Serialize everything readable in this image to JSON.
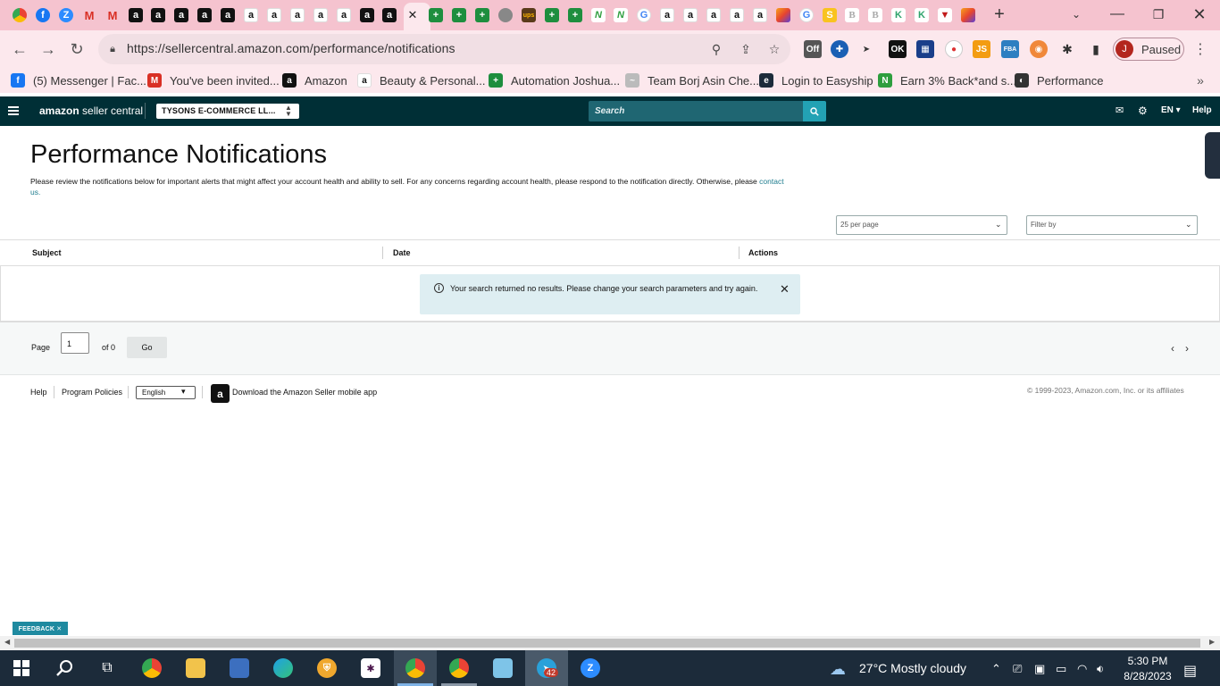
{
  "browser": {
    "tabs": [
      {
        "icon": "chrome-icon",
        "kind": "chrome",
        "glyph": ""
      },
      {
        "icon": "facebook-icon",
        "kind": "fb",
        "glyph": "f"
      },
      {
        "icon": "zoom-icon",
        "kind": "zoom",
        "glyph": "Z"
      },
      {
        "icon": "gmail-icon",
        "kind": "gmail",
        "glyph": "M"
      },
      {
        "icon": "gmail-icon",
        "kind": "gmail",
        "glyph": "M"
      },
      {
        "icon": "amazon-icon",
        "kind": "amz",
        "glyph": "a"
      },
      {
        "icon": "amazon-icon",
        "kind": "amz",
        "glyph": "a"
      },
      {
        "icon": "amazon-icon",
        "kind": "amz",
        "glyph": "a"
      },
      {
        "icon": "amazon-icon",
        "kind": "amz",
        "glyph": "a"
      },
      {
        "icon": "amazon-icon",
        "kind": "amz",
        "glyph": "a"
      },
      {
        "icon": "amazon-smile-icon",
        "kind": "amz2",
        "glyph": "a"
      },
      {
        "icon": "amazon-smile-icon",
        "kind": "amz2",
        "glyph": "a"
      },
      {
        "icon": "amazon-smile-icon",
        "kind": "amz2",
        "glyph": "a"
      },
      {
        "icon": "amazon-smile-icon",
        "kind": "amz2",
        "glyph": "a"
      },
      {
        "icon": "amazon-smile-icon",
        "kind": "amz2",
        "glyph": "a"
      },
      {
        "icon": "amazon-icon",
        "kind": "amz",
        "glyph": "a"
      },
      {
        "icon": "amazon-icon",
        "kind": "amz",
        "glyph": "a"
      },
      {
        "icon": "close-icon",
        "kind": "active",
        "glyph": "✕"
      },
      {
        "icon": "sheets-icon",
        "kind": "green",
        "glyph": "+"
      },
      {
        "icon": "sheets-icon",
        "kind": "green",
        "glyph": "+"
      },
      {
        "icon": "sheets-icon",
        "kind": "green",
        "glyph": "+"
      },
      {
        "icon": "globe-icon",
        "kind": "globe",
        "glyph": ""
      },
      {
        "icon": "ups-icon",
        "kind": "ups",
        "glyph": "ups"
      },
      {
        "icon": "sheets-icon",
        "kind": "green",
        "glyph": "+"
      },
      {
        "icon": "sheets-icon",
        "kind": "green",
        "glyph": "+"
      },
      {
        "icon": "wave-icon",
        "kind": "gn",
        "glyph": "N"
      },
      {
        "icon": "wave-icon",
        "kind": "gn",
        "glyph": "N"
      },
      {
        "icon": "google-icon",
        "kind": "g",
        "glyph": "G"
      },
      {
        "icon": "amazon-smile-icon",
        "kind": "amz2",
        "glyph": "a"
      },
      {
        "icon": "amazon-smile-icon",
        "kind": "amz2",
        "glyph": "a"
      },
      {
        "icon": "amazon-smile-icon",
        "kind": "amz2",
        "glyph": "a"
      },
      {
        "icon": "amazon-smile-icon",
        "kind": "amz2",
        "glyph": "a"
      },
      {
        "icon": "amazon-smile-icon",
        "kind": "amz2",
        "glyph": "a"
      },
      {
        "icon": "pen-icon",
        "kind": "pen",
        "glyph": ""
      },
      {
        "icon": "google-icon",
        "kind": "g",
        "glyph": "G"
      },
      {
        "icon": "s-icon",
        "kind": "ys",
        "glyph": "S"
      },
      {
        "icon": "b-icon",
        "kind": "bz",
        "glyph": "B"
      },
      {
        "icon": "b-icon",
        "kind": "bz",
        "glyph": "B"
      },
      {
        "icon": "k-icon",
        "kind": "kk",
        "glyph": "K"
      },
      {
        "icon": "k-icon",
        "kind": "kk",
        "glyph": "K"
      },
      {
        "icon": "v-icon",
        "kind": "vv",
        "glyph": "▼"
      },
      {
        "icon": "pen-icon",
        "kind": "pen",
        "glyph": ""
      }
    ],
    "url": "https://sellercentral.amazon.com/performance/notifications",
    "profile_initial": "J",
    "profile_status": "Paused",
    "bookmarks": [
      {
        "label": "(5) Messenger | Fac...",
        "icon": "facebook-icon",
        "color": "#1877f2",
        "glyph": "f"
      },
      {
        "label": "You've been invited...",
        "icon": "gmail-icon",
        "color": "#d93025",
        "glyph": "M"
      },
      {
        "label": "Amazon",
        "icon": "amazon-icon",
        "color": "#111111",
        "glyph": "a"
      },
      {
        "label": "Beauty & Personal...",
        "icon": "amazon-smile-icon",
        "color": "#ffffff",
        "glyph": "a"
      },
      {
        "label": "Automation Joshua...",
        "icon": "sheets-icon",
        "color": "#1e8e3e",
        "glyph": "+"
      },
      {
        "label": "Team Borj Asin Che...",
        "icon": "wave-icon",
        "color": "#bbbbbb",
        "glyph": "~"
      },
      {
        "label": "Login to Easyship",
        "icon": "easyship-icon",
        "color": "#1c2b3a",
        "glyph": "e"
      },
      {
        "label": "Earn 3% Back*and s...",
        "icon": "wave-icon",
        "color": "#2e9e3e",
        "glyph": "N"
      },
      {
        "label": "Performance",
        "icon": "globe-icon",
        "color": "#333333",
        "glyph": "◐"
      }
    ]
  },
  "header": {
    "logo_bold": "amazon",
    "logo_rest": " seller central",
    "store_name": "TYSONS E-COMMERCE LL...",
    "search_placeholder": "Search",
    "language": "EN",
    "help": "Help"
  },
  "page": {
    "title": "Performance Notifications",
    "description": "Please review the notifications below for important alerts that might affect your account health and ability to sell. For any concerns regarding account health, please respond to the notification directly. Otherwise, please",
    "description_link": "contact us.",
    "per_page": "25 per page",
    "filter_placeholder": "Filter by",
    "columns": [
      "Subject",
      "Date",
      "Actions"
    ],
    "alert": "Your search returned no results. Please change your search parameters and try again.",
    "pager": {
      "page_label": "Page",
      "page_value": "1",
      "of_label": "of 0",
      "go": "Go"
    }
  },
  "footer": {
    "help": "Help",
    "program_policies": "Program Policies",
    "language": "English",
    "app_text": "Download the Amazon Seller mobile app",
    "copyright": "© 1999-2023, Amazon.com, Inc. or its affiliates"
  },
  "feedback": "FEEDBACK ✕",
  "taskbar": {
    "weather_temp": "27°C",
    "weather_text": "Mostly cloudy",
    "time": "5:30 PM",
    "date": "8/28/2023",
    "badge": "42"
  }
}
